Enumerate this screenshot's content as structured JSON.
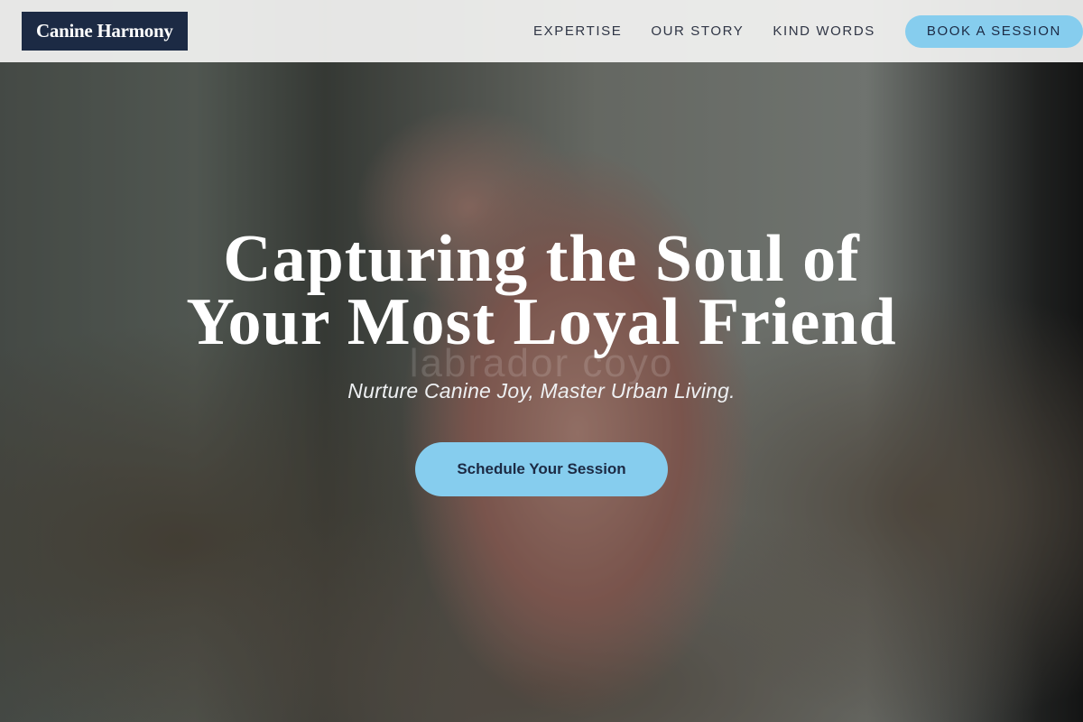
{
  "header": {
    "logo": "Canine Harmony",
    "nav": [
      "EXPERTISE",
      "OUR STORY",
      "KIND WORDS"
    ],
    "book_button": "BOOK A SESSION"
  },
  "hero": {
    "title_line1": "Capturing the Soul of",
    "title_line2": "Your Most Loyal Friend",
    "subtitle": "Nurture Canine Joy, Master Urban Living.",
    "cta": "Schedule Your Session",
    "watermark": "labrador coyo"
  },
  "colors": {
    "brand_navy": "#1c2a44",
    "accent_blue": "#86cdee"
  }
}
